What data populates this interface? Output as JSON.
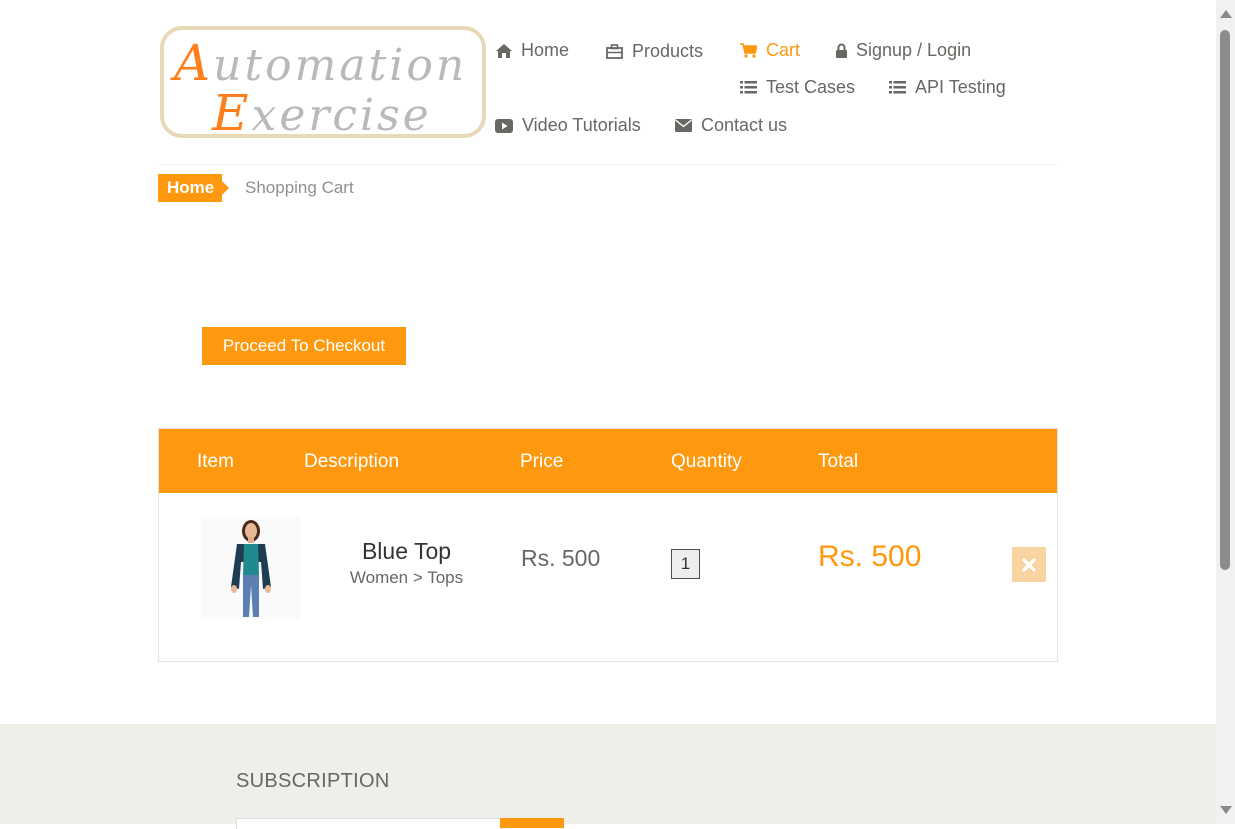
{
  "logo": {
    "line1_cap": "A",
    "line1_rest": "utomation",
    "line2_cap": "E",
    "line2_rest": "xercise"
  },
  "nav": {
    "home": "Home",
    "products": "Products",
    "cart": "Cart",
    "signup_login": "Signup / Login",
    "test_cases": "Test Cases",
    "api_testing": "API Testing",
    "video_tutorials": "Video Tutorials",
    "contact_us": "Contact us"
  },
  "breadcrumb": {
    "home": "Home",
    "current": "Shopping Cart"
  },
  "checkout_button": "Proceed To Checkout",
  "cart_table": {
    "headers": {
      "item": "Item",
      "description": "Description",
      "price": "Price",
      "quantity": "Quantity",
      "total": "Total"
    },
    "rows": [
      {
        "name": "Blue Top",
        "category": "Women > Tops",
        "price": "Rs. 500",
        "quantity": "1",
        "total": "Rs. 500",
        "image_icon": "woman-blue-top-photo"
      }
    ]
  },
  "footer": {
    "subscription_title": "SUBSCRIPTION"
  },
  "colors": {
    "accent": "#fe980f",
    "text": "#696763",
    "footer_bg": "#efeee8",
    "delete_bg": "#f8d4a0"
  },
  "icons": {
    "home": "home-icon",
    "products": "briefcase-icon",
    "cart": "shopping-cart-icon",
    "signup": "lock-icon",
    "test_cases": "list-icon",
    "api": "list-icon",
    "video": "youtube-play-icon",
    "contact": "envelope-icon",
    "delete": "close-icon"
  }
}
